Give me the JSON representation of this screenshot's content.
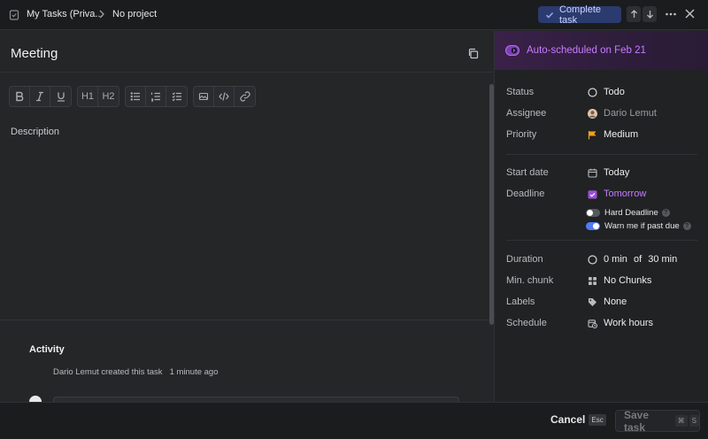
{
  "topbar": {
    "crumb_workspace": "My Tasks (Priva...",
    "crumb_project": "No project",
    "complete_label": "Complete task"
  },
  "task": {
    "title": "Meeting",
    "description_placeholder": "Description"
  },
  "toolbar": {
    "groups": [
      [
        "bold-icon",
        "italic-icon",
        "underline-icon"
      ],
      [
        "heading-1-icon",
        "heading-2-icon"
      ],
      [
        "bullet-list-icon",
        "numbered-list-icon",
        "checklist-icon"
      ],
      [
        "image-icon",
        "code-icon",
        "link-icon"
      ]
    ],
    "h1_label": "H1",
    "h2_label": "H2"
  },
  "activity": {
    "title": "Activity",
    "entry_text": "Dario Lemut created this task",
    "entry_time": "1 minute ago"
  },
  "banner": {
    "text": "Auto-scheduled on Feb 21",
    "color": "#c77dff"
  },
  "properties": {
    "status": {
      "label": "Status",
      "value": "Todo",
      "icon": "circle-outline-icon"
    },
    "assignee": {
      "label": "Assignee",
      "value": "Dario Lemut",
      "icon": "avatar"
    },
    "priority": {
      "label": "Priority",
      "value": "Medium",
      "icon": "flag-icon",
      "color": "#f0a020"
    },
    "start_date": {
      "label": "Start date",
      "value": "Today",
      "icon": "calendar-icon"
    },
    "deadline": {
      "label": "Deadline",
      "value": "Tomorrow",
      "icon": "calendar-check-icon",
      "color": "#c77dff"
    },
    "hard_deadline": {
      "label": "Hard Deadline",
      "on": false
    },
    "warn_past_due": {
      "label": "Warn me if past due",
      "on": true
    },
    "duration": {
      "label": "Duration",
      "min_value": "0 min",
      "of_label": "of",
      "max_value": "30 min",
      "icon": "circle-outline-icon"
    },
    "min_chunk": {
      "label": "Min. chunk",
      "value": "No Chunks",
      "icon": "grid-icon"
    },
    "labels": {
      "label": "Labels",
      "value": "None",
      "icon": "tag-icon"
    },
    "schedule": {
      "label": "Schedule",
      "value": "Work hours",
      "icon": "calendar-clock-icon"
    }
  },
  "footer": {
    "cancel_label": "Cancel",
    "cancel_shortcut": "Esc",
    "save_label": "Save task",
    "save_shortcut_mod": "⌘",
    "save_shortcut_key": "S"
  }
}
